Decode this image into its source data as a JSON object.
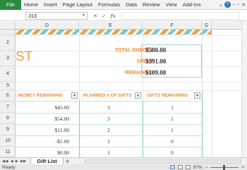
{
  "ribbon": {
    "file_tab": "File",
    "tabs": [
      "Home",
      "Insert",
      "Page Layout",
      "Formulas",
      "Data",
      "Review",
      "View",
      "Add-Ins"
    ]
  },
  "formula_bar": {
    "name_box": "J13",
    "fx_label": "fx",
    "value": ""
  },
  "columns": [
    "D",
    "E",
    "F",
    "G"
  ],
  "rows": [
    "",
    "2",
    "3",
    "4",
    "5",
    "6",
    "7",
    "8",
    "9",
    "10",
    "11"
  ],
  "sheet": {
    "title_partial": "ST",
    "budget": {
      "total_label": "TOTAL BUDGET",
      "total_value": "$500.00",
      "spent_label": "SPENT",
      "spent_value": "$391.00",
      "remaining_label": "REMAINING",
      "remaining_value": "$109.00"
    },
    "table": {
      "headers": [
        "MONEY REMAINING",
        "PLANNED # OF GIFTS",
        "GIFTS REMAINING"
      ],
      "rows": [
        {
          "money": "$45.00",
          "planned": "3",
          "remaining": "1"
        },
        {
          "money": "$54.00",
          "planned": "3",
          "remaining": "1"
        },
        {
          "money": "$11.00",
          "planned": "2",
          "remaining": "1"
        },
        {
          "money": "-$1.00",
          "planned": "1",
          "remaining": "0"
        },
        {
          "money": "$0.00",
          "planned": "1",
          "remaining": "0"
        }
      ]
    }
  },
  "sheet_tabs": {
    "active": "Gift List"
  },
  "status": {
    "left": "Ready",
    "zoom": "97%"
  },
  "colors": {
    "accent_orange": "#ef8a2f",
    "accent_teal": "#7cc7c0",
    "file_tab_green": "#2a8a3d"
  }
}
